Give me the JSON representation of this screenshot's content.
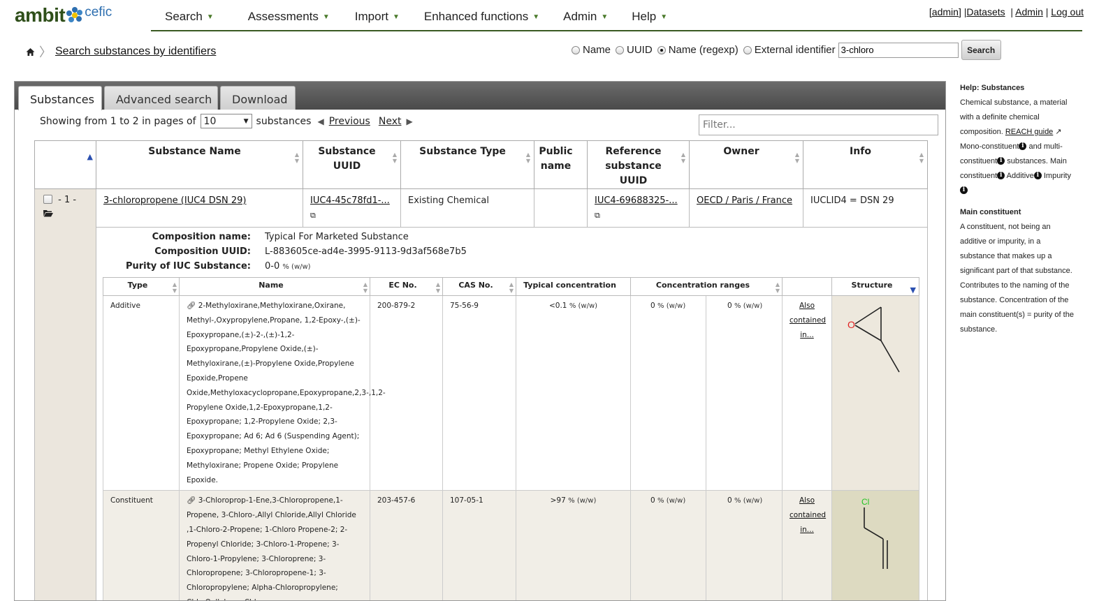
{
  "logo": {
    "main": "ambit",
    "partner": "cefic"
  },
  "nav": {
    "items": [
      {
        "label": "Search"
      },
      {
        "label": "Assessments"
      },
      {
        "label": "Import"
      },
      {
        "label": "Enhanced functions"
      },
      {
        "label": "Admin"
      },
      {
        "label": "Help"
      }
    ],
    "user_links": {
      "user": "[admin]",
      "datasets": "Datasets",
      "admin": "Admin",
      "logout": "Log out"
    }
  },
  "breadcrumb": {
    "title": "Search substances by identifiers"
  },
  "search": {
    "options": [
      "Name",
      "UUID",
      "Name (regexp)",
      "External identifier"
    ],
    "selected": "Name (regexp)",
    "value": "3-chloro",
    "button": "Search"
  },
  "tabs": [
    "Substances",
    "Advanced search",
    "Download"
  ],
  "paging": {
    "showing": "Showing from 1 to 2 in pages of",
    "page_size": "10",
    "unit": "substances",
    "previous": "Previous",
    "next": "Next",
    "filter_placeholder": "Filter..."
  },
  "table": {
    "headers": [
      "Substance Name",
      "Substance UUID",
      "Substance Type",
      "Public name",
      "Reference substance UUID",
      "Owner",
      "Info"
    ],
    "row": {
      "index": "- 1 -",
      "name": "3-chloropropene (IUC4 DSN 29)",
      "uuid": "IUC4-45c78fd1-...",
      "type": "Existing Chemical",
      "public_name": "",
      "ref_uuid": "IUC4-69688325-...",
      "owner": "OECD / Paris / France",
      "info": "IUCLID4 = DSN 29"
    }
  },
  "composition": {
    "name_label": "Composition name:",
    "name": "Typical For Marketed Substance",
    "uuid_label": "Composition UUID:",
    "uuid": "L-883605ce-ad4e-3995-9113-9d3af568e7b5",
    "purity_label": "Purity of IUC Substance:",
    "purity": "0-0",
    "purity_unit": "% (w/w)",
    "headers": [
      "Type",
      "Name",
      "EC No.",
      "CAS No.",
      "Typical concentration",
      "Concentration ranges",
      "",
      "Structure"
    ],
    "rows": [
      {
        "type": "Additive",
        "name": "2-Methyloxirane,Methyloxirane,Oxirane, Methyl-,Oxypropylene,Propane, 1,2-Epoxy-,(±)-Epoxypropane,(±)-2-,(±)-1,2-Epoxypropane,Propylene Oxide,(±)-Methyloxirane,(±)-Propylene Oxide,Propylene Epoxide,Propene Oxide,Methyloxacyclopropane,Epoxypropane,2,3-,1,2-Propylene Oxide,1,2-Epoxypropane,1,2-Epoxypropane; 1,2-Propylene Oxide; 2,3-Epoxypropane; Ad 6; Ad 6 (Suspending Agent); Epoxypropane; Methyl Ethylene Oxide; Methyloxirane; Propene Oxide; Propylene Epoxide.",
        "ec": "200-879-2",
        "cas": "75-56-9",
        "typical": "<0.1",
        "range_low": "0",
        "range_high": "0",
        "unit": "% (w/w)",
        "also": "Also contained in...",
        "atom": "O"
      },
      {
        "type": "Constituent",
        "name": "3-Chloroprop-1-Ene,3-Chloropropene,1-Propene, 3-Chloro-,Allyl Chloride,Allyl Chloride ,1-Chloro-2-Propene; 1-Chloro Propene-2; 2-Propenyl Chloride; 3-Chloro-1-Propene; 3-Chloro-1-Propylene; 3-Chloroprene; 3-Chloropropene; 3-Chloropropene-1; 3-Chloropropylene; Alpha-Chloropropylene; Chlo,Oallylene; Chloropropene.",
        "ec": "203-457-6",
        "cas": "107-05-1",
        "typical": ">97",
        "range_low": "0",
        "range_high": "0",
        "unit": "% (w/w)",
        "also": "Also contained in...",
        "atom": "Cl"
      }
    ]
  },
  "help": {
    "title": "Help: Substances",
    "p1a": "Chemical substance, a material with a definite chemical composition.",
    "reach": "REACH guide",
    "mono": "Mono-constituent",
    "and_multi": "and multi-constituent",
    "substances": "substances. Main constituent",
    "additive": "Additive",
    "impurity": "Impurity",
    "main_title": "Main constituent",
    "main_text": "A constituent, not being an additive or impurity, in a substance that makes up a significant part of that substance. Contributes to the naming of the substance. Concentration of the main constituent(s) = purity of the substance."
  },
  "colors": {
    "accent_green": "#3a5a22",
    "tabbar": "#555555",
    "row_shade": "#ebe6dd",
    "oxygen": "#e02020",
    "chlorine": "#22c422"
  }
}
